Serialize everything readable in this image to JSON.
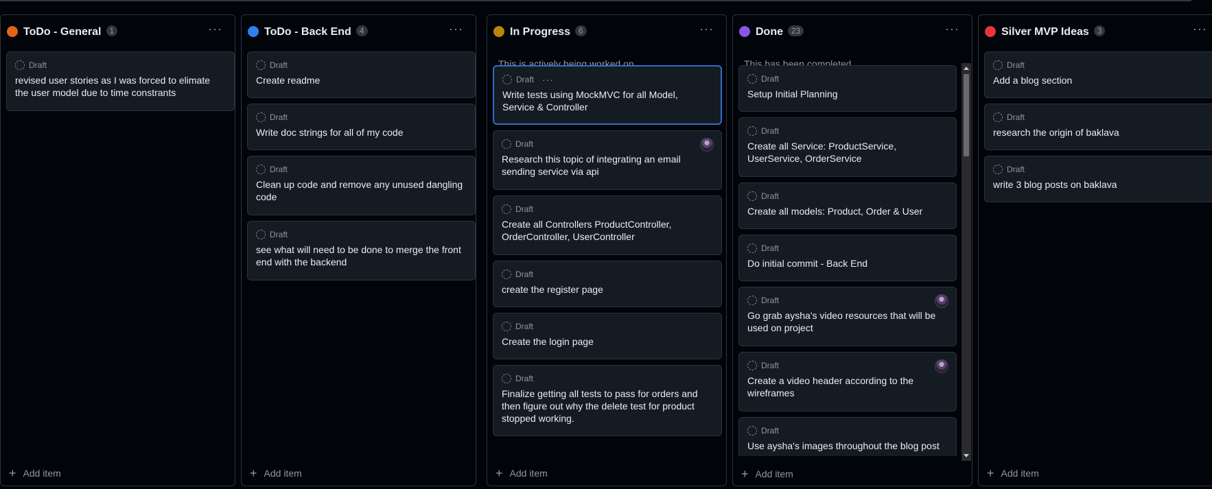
{
  "board": {
    "add_item_label": "Add item",
    "draft_label": "Draft",
    "columns": [
      {
        "title": "ToDo - General",
        "count": "1",
        "color": "#e0641a",
        "description": "",
        "cards": [
          {
            "title": "revised user stories as I was forced to elimate the user model due to time constrants"
          }
        ]
      },
      {
        "title": "ToDo - Back End",
        "count": "4",
        "color": "#2f80ed",
        "description": "",
        "cards": [
          {
            "title": "Create readme"
          },
          {
            "title": "Write doc strings for all of my code"
          },
          {
            "title": "Clean up code and remove any unused dangling code"
          },
          {
            "title": "see what will need to be done to merge the front end with the backend"
          }
        ]
      },
      {
        "title": "In Progress",
        "count": "6",
        "color": "#b8860b",
        "description": "This is actively being worked on",
        "cards": [
          {
            "title": "Write tests using MockMVC for all Model, Service & Controller"
          },
          {
            "title": "Research this topic of integrating an email sending service via api"
          },
          {
            "title": "Create all Controllers ProductController, OrderController, UserController"
          },
          {
            "title": "create the register page"
          },
          {
            "title": "Create the login page"
          },
          {
            "title": "Finalize getting all tests to pass for orders and then figure out why the delete test for product stopped working."
          }
        ]
      },
      {
        "title": "Done",
        "count": "23",
        "color": "#8957e5",
        "description": "This has been completed",
        "cards": [
          {
            "title": "Setup Initial Planning"
          },
          {
            "title": "Create all Service: ProductService, UserService, OrderService"
          },
          {
            "title": "Create all models: Product, Order & User"
          },
          {
            "title": "Do initial commit - Back End"
          },
          {
            "title": "Go grab aysha's video resources that will be used on project"
          },
          {
            "title": "Create a video header according to the wireframes"
          },
          {
            "title": "Use aysha's images throughout the blog post"
          }
        ]
      },
      {
        "title": "Silver MVP Ideas",
        "count": "3",
        "color": "#e5363d",
        "description": "",
        "cards": [
          {
            "title": "Add a blog section"
          },
          {
            "title": "research the origin of baklava"
          },
          {
            "title": "write 3 blog posts on baklava"
          }
        ]
      }
    ]
  }
}
